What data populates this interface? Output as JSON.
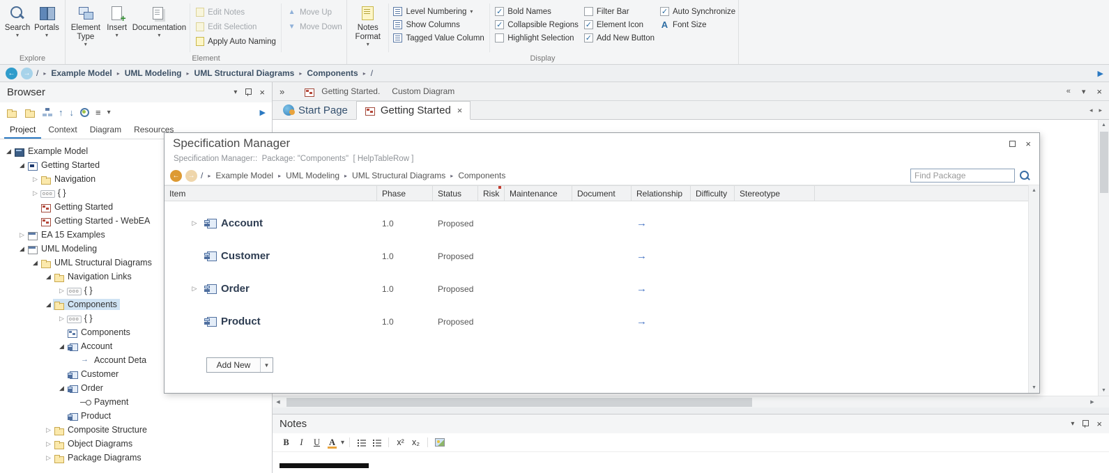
{
  "ribbon": {
    "explore": {
      "label": "Explore",
      "search": "Search",
      "portals": "Portals"
    },
    "element": {
      "label": "Element",
      "element_type": "Element Type",
      "insert": "Insert",
      "documentation": "Documentation",
      "edit_notes": "Edit Notes",
      "edit_selection": "Edit Selection",
      "apply_auto_naming": "Apply Auto Naming",
      "move_up": "Move Up",
      "move_down": "Move Down",
      "toggles": [
        {
          "label": "Level Numbering",
          "dropdown": true
        },
        {
          "label": "Show Columns"
        },
        {
          "label": "Tagged Value Column"
        }
      ]
    },
    "display": {
      "label": "Display",
      "notes_format": "Notes Format",
      "col1": [
        {
          "label": "Bold Names",
          "checked": true
        },
        {
          "label": "Collapsible Regions",
          "checked": true
        },
        {
          "label": "Highlight Selection",
          "checked": false
        }
      ],
      "col2": [
        {
          "label": "Filter Bar",
          "checked": false
        },
        {
          "label": "Element Icon",
          "checked": true
        },
        {
          "label": "Add New Button",
          "checked": true
        }
      ],
      "col3": [
        {
          "label": "Auto Synchronize",
          "checked": true
        },
        {
          "label": "Font Size",
          "icon": "A"
        }
      ]
    }
  },
  "breadcrumb": {
    "root": "/",
    "segments": [
      "Example Model",
      "UML Modeling",
      "UML Structural Diagrams",
      "Components"
    ],
    "trailing": "/"
  },
  "browser": {
    "title": "Browser",
    "tabs": [
      "Project",
      "Context",
      "Diagram",
      "Resources"
    ],
    "tree": [
      {
        "label": "Example Model",
        "indent": 0,
        "expand": "open",
        "icon": "model"
      },
      {
        "label": "Getting Started",
        "indent": 1,
        "expand": "open",
        "icon": "view"
      },
      {
        "label": "Navigation",
        "indent": 2,
        "expand": "closed",
        "icon": "folder"
      },
      {
        "label": "{ }",
        "indent": 2,
        "expand": "closed",
        "icon": "features"
      },
      {
        "label": "Getting Started",
        "indent": 2,
        "expand": "none",
        "icon": "diagram"
      },
      {
        "label": "Getting Started - WebEA",
        "indent": 2,
        "expand": "none",
        "icon": "diagram"
      },
      {
        "label": "EA 15 Examples",
        "indent": 1,
        "expand": "closed",
        "icon": "view2"
      },
      {
        "label": "UML Modeling",
        "indent": 1,
        "expand": "open",
        "icon": "view2"
      },
      {
        "label": "UML Structural Diagrams",
        "indent": 2,
        "expand": "open",
        "icon": "folder"
      },
      {
        "label": "Navigation Links",
        "indent": 3,
        "expand": "open",
        "icon": "folder"
      },
      {
        "label": "{ }",
        "indent": 4,
        "expand": "closed",
        "icon": "features"
      },
      {
        "label": "Components",
        "indent": 3,
        "expand": "open",
        "icon": "folder",
        "selected": true
      },
      {
        "label": "{ }",
        "indent": 4,
        "expand": "closed",
        "icon": "features"
      },
      {
        "label": "Components",
        "indent": 4,
        "expand": "none",
        "icon": "diagram2"
      },
      {
        "label": "Account",
        "indent": 4,
        "expand": "open",
        "icon": "component"
      },
      {
        "label": "Account Deta",
        "indent": 5,
        "expand": "none",
        "icon": "link"
      },
      {
        "label": "Customer",
        "indent": 4,
        "expand": "none",
        "icon": "component"
      },
      {
        "label": "Order",
        "indent": 4,
        "expand": "open",
        "icon": "component"
      },
      {
        "label": "Payment",
        "indent": 5,
        "expand": "none",
        "icon": "port"
      },
      {
        "label": "Product",
        "indent": 4,
        "expand": "none",
        "icon": "component"
      },
      {
        "label": "Composite Structure",
        "indent": 3,
        "expand": "closed",
        "icon": "folder"
      },
      {
        "label": "Object Diagrams",
        "indent": 3,
        "expand": "closed",
        "icon": "folder"
      },
      {
        "label": "Package Diagrams",
        "indent": 3,
        "expand": "closed",
        "icon": "folder"
      }
    ]
  },
  "main": {
    "strip_primary": "Getting Started.",
    "strip_secondary": "Custom Diagram",
    "tabs": [
      {
        "label": "Start Page",
        "active": false
      },
      {
        "label": "Getting Started",
        "active": true
      }
    ]
  },
  "spec_manager": {
    "title": "Specification Manager",
    "subtitle": "Specification Manager::  Package: \"Components\"  [ HelpTableRow ]",
    "breadcrumb": {
      "root": "/",
      "segments": [
        "Example Model",
        "UML Modeling",
        "UML Structural Diagrams",
        "Components"
      ]
    },
    "find_placeholder": "Find Package",
    "columns": [
      "Item",
      "Phase",
      "Status",
      "Risk",
      "Maintenance",
      "Document",
      "Relationship",
      "Difficulty",
      "Stereotype"
    ],
    "rows": [
      {
        "name": "Account",
        "phase": "1.0",
        "status": "Proposed",
        "expandable": true,
        "relationship": true
      },
      {
        "name": "Customer",
        "phase": "1.0",
        "status": "Proposed",
        "expandable": false,
        "relationship": true
      },
      {
        "name": "Order",
        "phase": "1.0",
        "status": "Proposed",
        "expandable": true,
        "relationship": true
      },
      {
        "name": "Product",
        "phase": "1.0",
        "status": "Proposed",
        "expandable": false,
        "relationship": true
      }
    ],
    "add_new": "Add New"
  },
  "notes": {
    "title": "Notes",
    "toolbar": {
      "bold": "B",
      "italic": "I",
      "underline": "U",
      "color": "A",
      "superscript": "x²",
      "subscript": "x₂"
    }
  }
}
